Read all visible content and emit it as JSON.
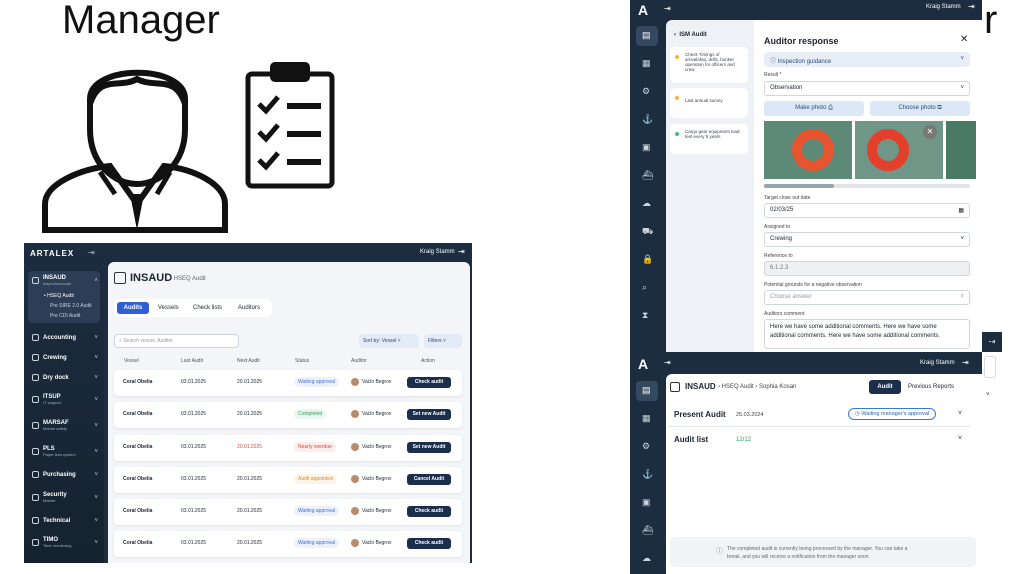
{
  "slide": {
    "title_left": "Manager",
    "title_right_fragment": "r"
  },
  "dashboard": {
    "logo": "ARTALEX",
    "user": "Kraig Stamm",
    "sidebar": [
      {
        "label": "INSAUD",
        "sub": "Inspection/audit"
      },
      {
        "label": "HSEQ Audit"
      },
      {
        "label": "Pre SIRE 2.0 Audit"
      },
      {
        "label": "Pre CDI Audit"
      },
      {
        "label": "Accounting",
        "sub": ""
      },
      {
        "label": "Crewing",
        "sub": ""
      },
      {
        "label": "Dry dock",
        "sub": ""
      },
      {
        "label": "ITSUP",
        "sub": "IT support"
      },
      {
        "label": "MARSAF",
        "sub": "Marine safety"
      },
      {
        "label": "PLS",
        "sub": "Paper less system"
      },
      {
        "label": "Purchasing",
        "sub": ""
      },
      {
        "label": "Security",
        "sub": "Market"
      },
      {
        "label": "Technical",
        "sub": ""
      },
      {
        "label": "TIMO",
        "sub": "Time monitoring"
      }
    ],
    "page_title": "INSAUD",
    "breadcrumb": "HSEQ Audit",
    "tabs": [
      "Audits",
      "Vessels",
      "Check lists",
      "Auditors"
    ],
    "search_placeholder": "Search vessel, Auditor",
    "sort_label": "Sort by: Vessel",
    "filters_label": "Filters",
    "columns": [
      "Vessel",
      "Last Audit",
      "Next Audit",
      "Status",
      "Auditor",
      "Action"
    ],
    "rows": [
      {
        "vessel": "Coral Obelia",
        "last": "03.01.2025",
        "next": "20.01.2025",
        "status": "Waiting approval",
        "status_color": "#3b6fd8",
        "auditor": "Vaclo Begrov",
        "action": "Check audit"
      },
      {
        "vessel": "Coral Obelia",
        "last": "03.01.2025",
        "next": "20.01.2025",
        "status": "Completed",
        "status_color": "#2e9d59",
        "auditor": "Vaclo Begrov",
        "action": "Set new Audit"
      },
      {
        "vessel": "Coral Obelia",
        "last": "03.01.2025",
        "next": "20.01.2025",
        "status": "Nearly overdue",
        "status_color": "#d94a3a",
        "auditor": "Vaclo Begrov",
        "action": "Set new Audit"
      },
      {
        "vessel": "Coral Obelia",
        "last": "03.01.2025",
        "next": "20.01.2025",
        "status": "Audit appointed",
        "status_color": "#e08a24",
        "auditor": "Vaclo Begrov",
        "action": "Cancel Audit"
      },
      {
        "vessel": "Coral Obelia",
        "last": "03.01.2025",
        "next": "20.01.2025",
        "status": "Waiting approval",
        "status_color": "#3b6fd8",
        "auditor": "Vaclo Begrov",
        "action": "Check audit"
      },
      {
        "vessel": "Coral Obelia",
        "last": "03.01.2025",
        "next": "20.01.2025",
        "status": "Waiting approval",
        "status_color": "#3b6fd8",
        "auditor": "Vaclo Begrov",
        "action": "Check audit"
      }
    ]
  },
  "auditor_screen": {
    "user": "Kraig Stamm",
    "list_title": "ISM Audit",
    "list_items": [
      {
        "text": "Check Timings of arrival/dep, drills, bunker operation for officers and crew",
        "color": "#f2b632"
      },
      {
        "text": "Last annual survey",
        "color": "#f2b632"
      },
      {
        "text": "Cargo gear equipment load test every 5 years",
        "color": "#3ec27a"
      }
    ],
    "panel_title": "Auditor response",
    "inspection_guidance": "Inspection guidance",
    "result_label": "Result *",
    "result_value": "Observation",
    "make_photo": "Make photo",
    "choose_photo": "Choose photo",
    "target_label": "Target close out date",
    "target_value": "02/03/25",
    "assigned_label": "Assigned to",
    "assigned_value": "Crewing",
    "reference_label": "Reference to",
    "reference_value": "6.1.2.3",
    "grounds_label": "Potential grounds for a negative observation",
    "grounds_placeholder": "Choose answer",
    "comment_label": "Auditors comment",
    "comment_value": "Here we have some additional comments. Here we have some additional comments. Here we have some additional comments."
  },
  "manager_screen": {
    "user": "Kraig Stamm",
    "title": "INSAUD",
    "breadcrumb1": "HSEQ Audit",
    "breadcrumb2": "Sophia Kosan",
    "tab_active": "Audit",
    "tab_other": "Previous Reports",
    "present_label": "Present Audit",
    "present_date": "25.03.2024",
    "status": "Waiting manager's approval",
    "audit_list_label": "Audit list",
    "audit_list_count": "12/12",
    "notice": "The completed audit is currently being processed by the manager. You can take a break, and you will receive a notification from the manager soon."
  }
}
